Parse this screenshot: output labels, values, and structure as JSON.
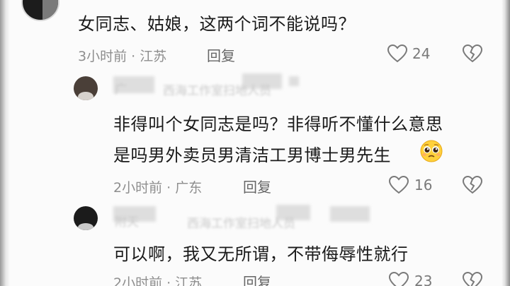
{
  "comments": [
    {
      "text": "女同志、姑娘，这两个词不能说吗？",
      "meta": "3小时前 · 江苏",
      "reply_label": "回复",
      "likes": "24",
      "like_icon": "heart-outline-icon",
      "dislike_icon": "broken-heart-icon"
    }
  ],
  "replies": [
    {
      "author_blurred": "广",
      "author_blurred_2": "西海工作室扫地人员",
      "text_line1": "非得叫个女同志是吗？非得听不懂什么意思",
      "text_line2": "是吗男外卖员男清洁工男博士男先生",
      "emoji_icon": "pleading-face-emoji",
      "meta": "2小时前 · 广东",
      "reply_label": "回复",
      "likes": "16"
    },
    {
      "author_blurred": "附天",
      "author_blurred_2": "西海工作室扫地人员",
      "text": "可以啊，我又无所谓，不带侮辱性就行",
      "meta": "2小时前 · 江苏",
      "reply_label": "回复",
      "likes": "23"
    }
  ],
  "colors": {
    "text_primary": "#1a1a1a",
    "text_meta": "#8e8e8e",
    "icon_stroke": "#7a7a7a"
  }
}
